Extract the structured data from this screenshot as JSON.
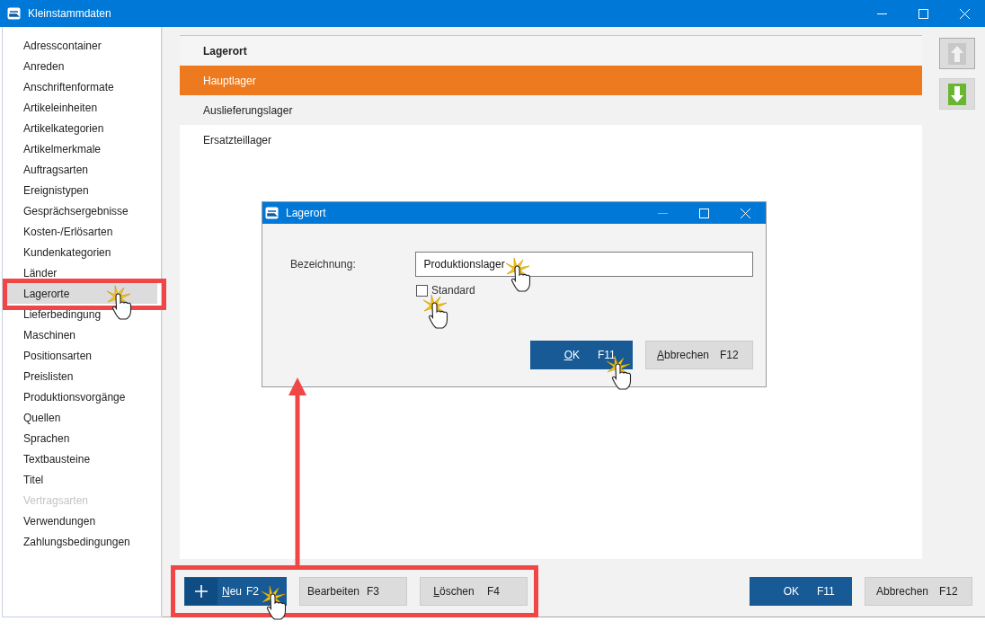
{
  "window": {
    "title": "Kleinstammdaten"
  },
  "sidebar": {
    "items": [
      {
        "label": "Adresscontainer",
        "selected": false,
        "disabled": false
      },
      {
        "label": "Anreden",
        "selected": false,
        "disabled": false
      },
      {
        "label": "Anschriftenformate",
        "selected": false,
        "disabled": false
      },
      {
        "label": "Artikeleinheiten",
        "selected": false,
        "disabled": false
      },
      {
        "label": "Artikelkategorien",
        "selected": false,
        "disabled": false
      },
      {
        "label": "Artikelmerkmale",
        "selected": false,
        "disabled": false
      },
      {
        "label": "Auftragsarten",
        "selected": false,
        "disabled": false
      },
      {
        "label": "Ereignistypen",
        "selected": false,
        "disabled": false
      },
      {
        "label": "Gesprächsergebnisse",
        "selected": false,
        "disabled": false
      },
      {
        "label": "Kosten-/Erlösarten",
        "selected": false,
        "disabled": false
      },
      {
        "label": "Kundenkategorien",
        "selected": false,
        "disabled": false
      },
      {
        "label": "Länder",
        "selected": false,
        "disabled": false
      },
      {
        "label": "Lagerorte",
        "selected": true,
        "disabled": false
      },
      {
        "label": "Lieferbedingung",
        "selected": false,
        "disabled": false
      },
      {
        "label": "Maschinen",
        "selected": false,
        "disabled": false
      },
      {
        "label": "Positionsarten",
        "selected": false,
        "disabled": false
      },
      {
        "label": "Preislisten",
        "selected": false,
        "disabled": false
      },
      {
        "label": "Produktionsvorgänge",
        "selected": false,
        "disabled": false
      },
      {
        "label": "Quellen",
        "selected": false,
        "disabled": false
      },
      {
        "label": "Sprachen",
        "selected": false,
        "disabled": false
      },
      {
        "label": "Textbausteine",
        "selected": false,
        "disabled": false
      },
      {
        "label": "Titel",
        "selected": false,
        "disabled": false
      },
      {
        "label": "Vertragsarten",
        "selected": false,
        "disabled": true
      },
      {
        "label": "Verwendungen",
        "selected": false,
        "disabled": false
      },
      {
        "label": "Zahlungsbedingungen",
        "selected": false,
        "disabled": false
      }
    ]
  },
  "list": {
    "column": "Lagerort",
    "rows": [
      {
        "label": "Hauptlager",
        "selected": true
      },
      {
        "label": "Auslieferungslager",
        "selected": false
      },
      {
        "label": "Ersatzteillager",
        "selected": false
      }
    ]
  },
  "move_buttons": [
    {
      "kind": "up",
      "disabled": true
    },
    {
      "kind": "down",
      "disabled": false
    }
  ],
  "toolbar": [
    {
      "kind": "new",
      "label": "Neu",
      "shortcut": "F2",
      "mnemonic": true
    },
    {
      "kind": "plain",
      "label": "Bearbeiten",
      "shortcut": "F3",
      "mnemonic": false
    },
    {
      "kind": "plain",
      "label": "Löschen",
      "shortcut": "F4",
      "mnemonic": true
    }
  ],
  "footer_buttons": [
    {
      "label": "OK",
      "shortcut": "F11",
      "primary": true,
      "mnemonic": false
    },
    {
      "label": "Abbrechen",
      "shortcut": "F12",
      "primary": false,
      "mnemonic": false
    }
  ],
  "dialog": {
    "title": "Lagerort",
    "field": {
      "label": "Bezeichnung:",
      "value": "Produktionslager"
    },
    "checkbox": {
      "label": "Standard",
      "checked": false
    },
    "buttons": [
      {
        "label": "OK",
        "shortcut": "F11",
        "primary": true,
        "mnemonic": true
      },
      {
        "label": "Abbrechen",
        "shortcut": "F12",
        "primary": false,
        "mnemonic": true
      }
    ]
  }
}
